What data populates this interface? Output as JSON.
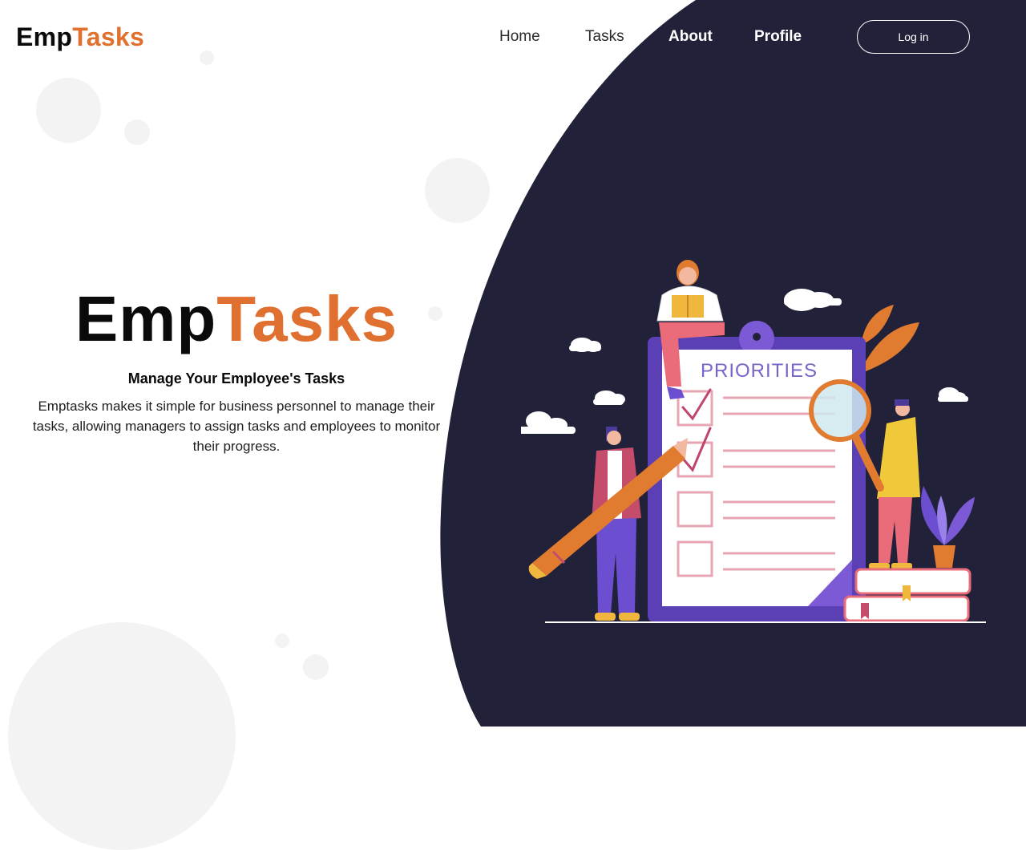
{
  "header": {
    "logo": {
      "part1": "Emp",
      "part2": "Tasks"
    },
    "nav": [
      {
        "label": "Home"
      },
      {
        "label": "Tasks"
      },
      {
        "label": "About"
      },
      {
        "label": "Profile"
      }
    ],
    "login_label": "Log in"
  },
  "hero": {
    "title": {
      "part1": "Emp",
      "part2": "Tasks"
    },
    "subtitle": "Manage Your Employee's Tasks",
    "description": "Emptasks makes it simple for business personnel to manage their tasks, allowing managers to assign tasks and employees to monitor their progress."
  },
  "illustration": {
    "board_label": "PRIORITIES"
  },
  "colors": {
    "accent": "#e0702f",
    "dark_panel": "#22213a",
    "board_purple": "#5a3fb5",
    "text_dark": "#0a0a0a"
  }
}
